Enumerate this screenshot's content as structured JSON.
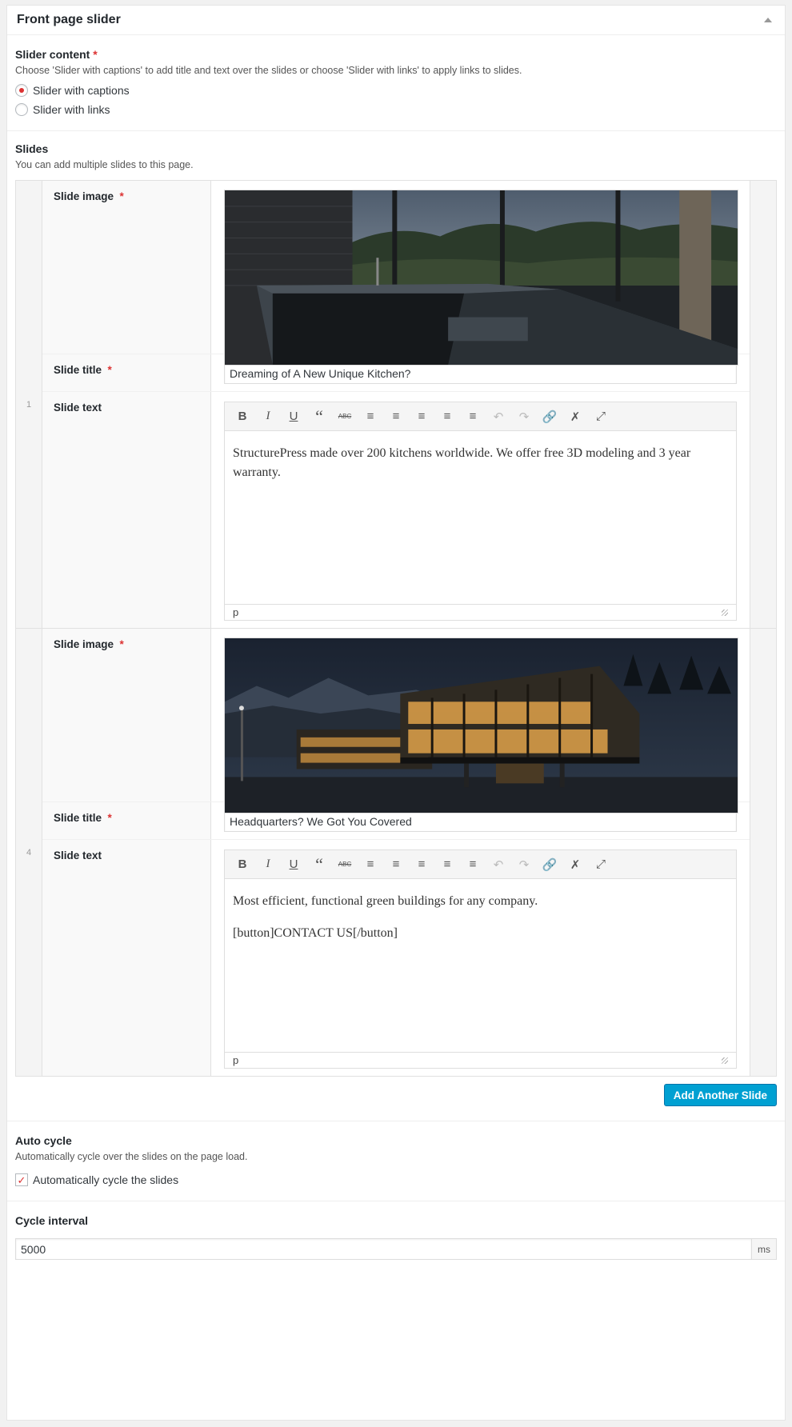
{
  "metabox": {
    "title": "Front page slider"
  },
  "slider_content": {
    "label": "Slider content",
    "required": "*",
    "description": "Choose 'Slider with captions' to add title and text over the slides or choose 'Slider with links' to apply links to slides.",
    "options": [
      {
        "label": "Slider with captions",
        "selected": true
      },
      {
        "label": "Slider with links",
        "selected": false
      }
    ]
  },
  "slides": {
    "label": "Slides",
    "description": "You can add multiple slides to this page.",
    "field_labels": {
      "image": "Slide image",
      "title": "Slide title",
      "text": "Slide text",
      "required": "*"
    },
    "toolbar": [
      "bold-icon",
      "italic-icon",
      "underline-icon",
      "blockquote-icon",
      "strikethrough-icon",
      "bullet-list-icon",
      "numbered-list-icon",
      "align-left-icon",
      "align-center-icon",
      "align-right-icon",
      "undo-icon",
      "redo-icon",
      "link-icon",
      "unlink-icon",
      "fullscreen-icon"
    ],
    "items": [
      {
        "index": "1",
        "image": "kitchen interior with mountain view",
        "title": "Dreaming of A New Unique Kitchen?",
        "text": [
          "StructurePress made over 200 kitchens worldwide. We offer free 3D modeling and 3 year warranty."
        ],
        "status": "p"
      },
      {
        "index": "4",
        "image": "modern office building at night",
        "title": "Headquarters? We Got You Covered",
        "text": [
          "Most efficient, functional green buildings for any company.",
          "[button]CONTACT US[/button]"
        ],
        "status": "p"
      }
    ],
    "add_button": "Add Another Slide"
  },
  "auto_cycle": {
    "label": "Auto cycle",
    "description": "Automatically cycle over the slides on the page load.",
    "checkbox_label": "Automatically cycle the slides",
    "checked": true
  },
  "cycle_interval": {
    "label": "Cycle interval",
    "value": "5000",
    "unit": "ms"
  }
}
